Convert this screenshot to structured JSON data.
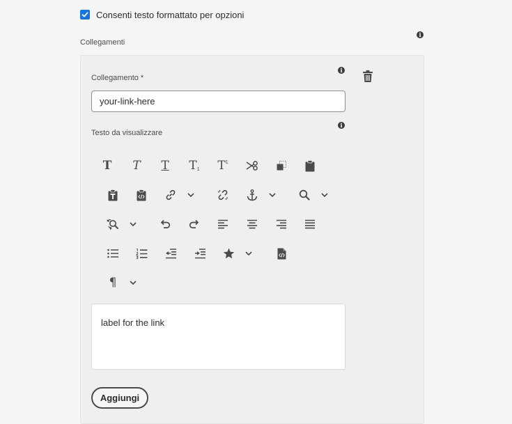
{
  "rich_text_option": {
    "label": "Consenti testo formattato per opzioni",
    "checked": true
  },
  "links_section": {
    "label": "Collegamenti",
    "link_field": {
      "label": "Collegamento *",
      "value": "your-link-here"
    },
    "display_text": {
      "label": "Testo da visualizzare",
      "value": "label for the link"
    },
    "add_button": "Aggiungi"
  },
  "toolbar": {
    "rows": [
      [
        "bold",
        "italic",
        "underline",
        "subscript",
        "superscript",
        "cut",
        "copy",
        "paste"
      ],
      [
        "paste-as-text",
        "paste-as-html",
        "link",
        "unlink",
        "anchor",
        "find"
      ],
      [
        "find-replace",
        "undo",
        "redo",
        "align-left",
        "align-center",
        "align-right",
        "justify"
      ],
      [
        "bulleted-list",
        "numbered-list",
        "outdent",
        "indent",
        "special-characters",
        "source-edit"
      ],
      [
        "paragraph-format"
      ]
    ],
    "glyphs": {
      "bold": "T",
      "italic": "T",
      "underline": "T",
      "subscript": "T",
      "subscript_mark": "1",
      "superscript": "T",
      "superscript_mark": "1",
      "paragraph": "¶"
    }
  },
  "colors": {
    "accent": "#1473e6",
    "icon": "#4b4b4b",
    "panel": "#efefef",
    "background": "#f5f5f5"
  }
}
